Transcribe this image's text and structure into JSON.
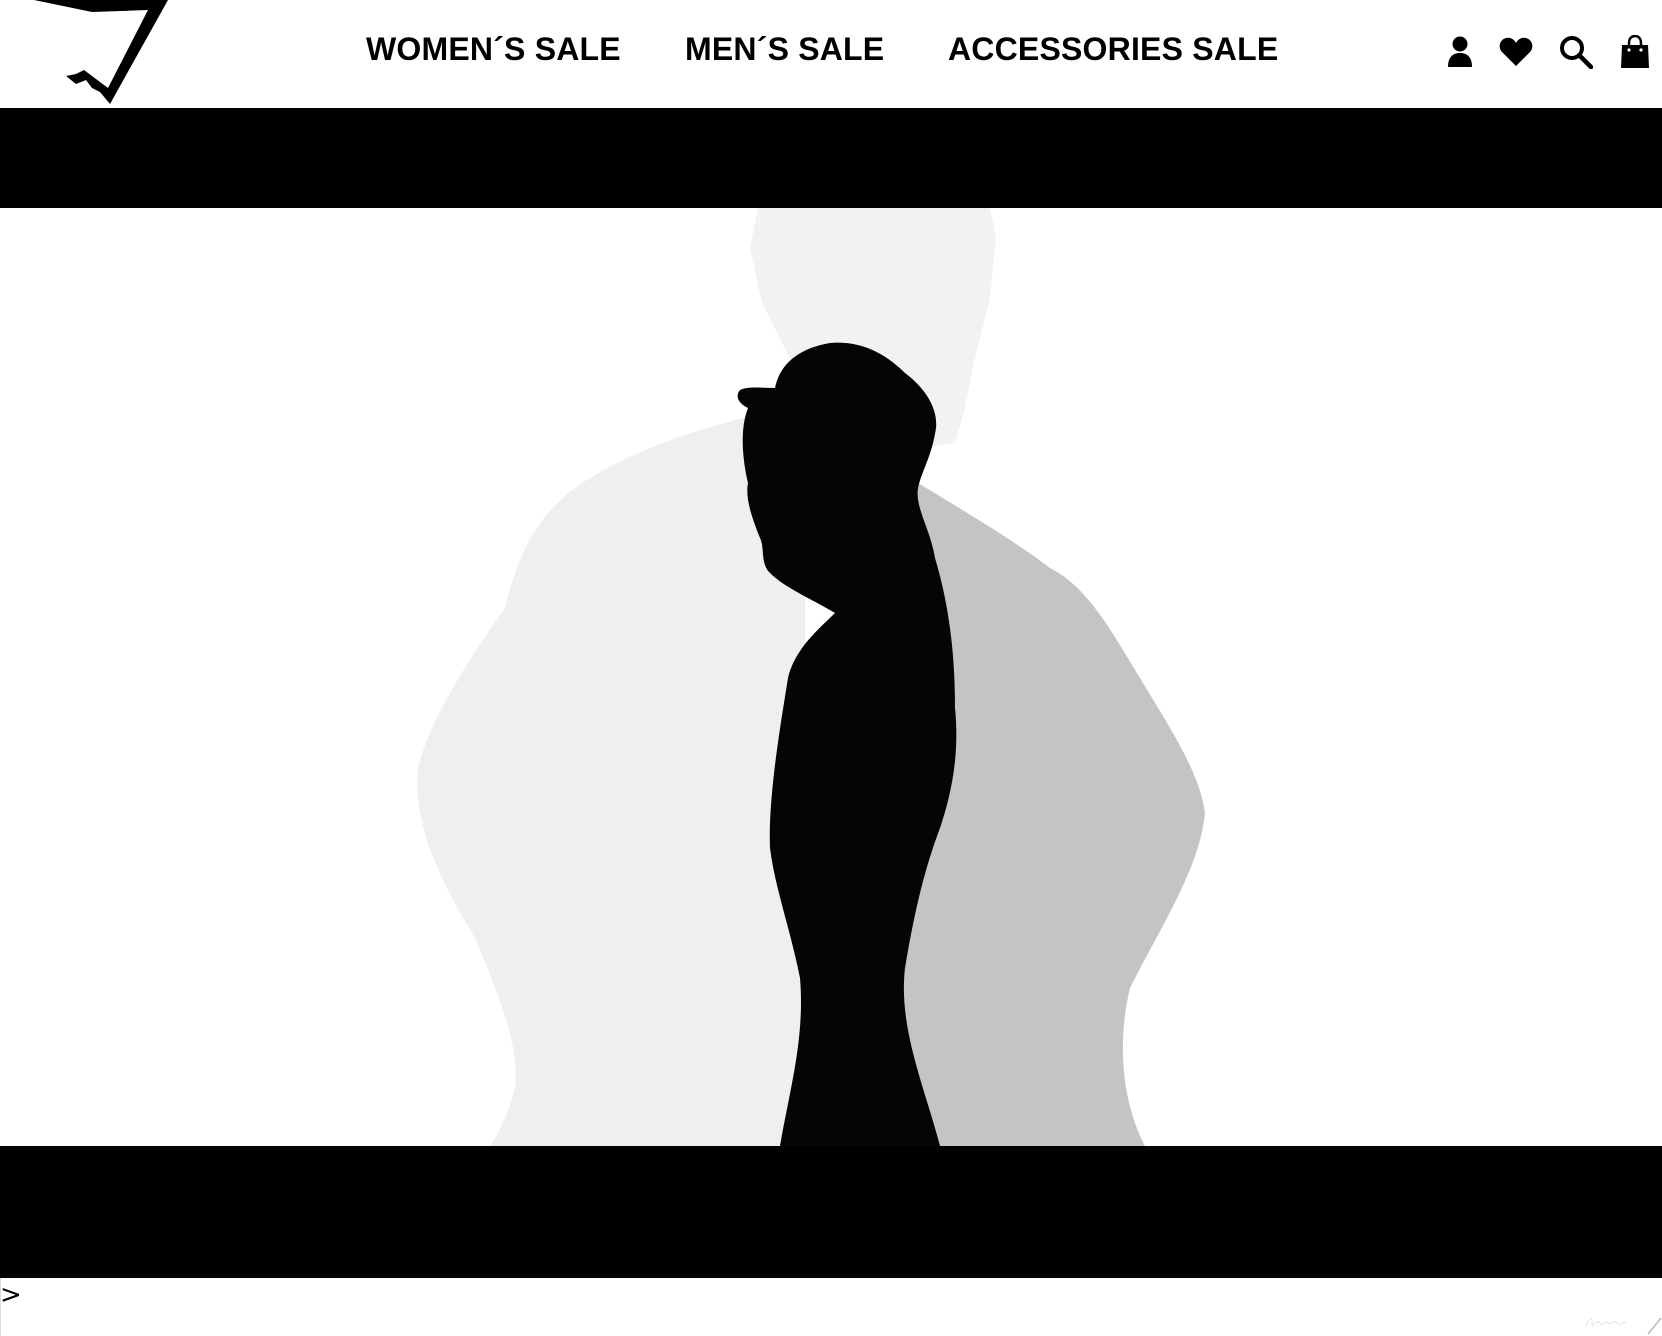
{
  "header": {
    "logo_icon": "gymshark-logo-icon",
    "nav": [
      {
        "label": "WOMEN´S SALE"
      },
      {
        "label": "MEN´S SALE"
      },
      {
        "label": "ACCESSORIES SALE"
      }
    ],
    "icons": [
      "account-icon",
      "wishlist-heart-icon",
      "search-icon",
      "shopping-bag-icon"
    ]
  },
  "hero": {
    "media": "silhouette-video-still",
    "signature_icon": "signature-mark-icon"
  },
  "carousel": {
    "next_label": ">"
  },
  "colors": {
    "background": "#ffffff",
    "foreground": "#000000",
    "shadow_light": "#efefef",
    "shadow_mid": "#c4c4c4"
  }
}
